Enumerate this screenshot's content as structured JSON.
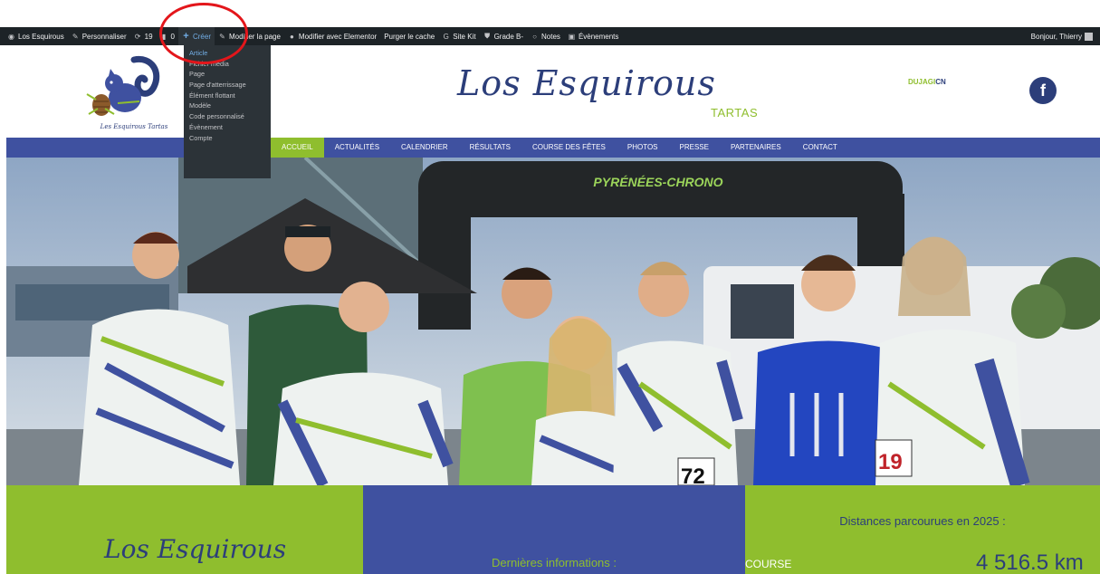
{
  "admin_bar": {
    "items": [
      {
        "label": "Los Esquirous",
        "icon": "wordpress-icon"
      },
      {
        "label": "Personnaliser",
        "icon": "brush-icon"
      },
      {
        "label": "19",
        "icon": "updates-icon"
      },
      {
        "label": "0",
        "icon": "comments-icon"
      },
      {
        "label": "Créer",
        "icon": "plus-icon"
      },
      {
        "label": "Modifier la page",
        "icon": "pencil-icon"
      },
      {
        "label": "Modifier avec Elementor",
        "icon": "elementor-icon"
      },
      {
        "label": "Purger le cache",
        "icon": ""
      },
      {
        "label": "Site Kit",
        "icon": "google-icon"
      },
      {
        "label": "Grade B-",
        "icon": "shield-icon"
      },
      {
        "label": "Notes",
        "icon": "notes-icon"
      },
      {
        "label": "Évènements",
        "icon": "calendar-icon"
      }
    ],
    "greeting": "Bonjour, Thierry"
  },
  "create_menu": {
    "items": [
      "Article",
      "Fichier média",
      "Page",
      "Page d'atterrissage",
      "Élément flottant",
      "Modèle",
      "Code personnalisé",
      "Évènement",
      "Compte"
    ],
    "active_index": 0
  },
  "header": {
    "logo_text": "Les Esquirous Tartas",
    "title": "Los Esquirous",
    "subtitle": "TARTAS",
    "sponsor_a": "DUJAGI",
    "sponsor_b": "CN",
    "facebook_icon": "f"
  },
  "nav": {
    "items": [
      "ACCUEIL",
      "ACTUALITÉS",
      "CALENDRIER",
      "RÉSULTATS",
      "COURSE DES FÊTES",
      "PHOTOS",
      "PRESSE",
      "PARTENAIRES",
      "CONTACT"
    ],
    "active_index": 0
  },
  "hero": {
    "arch_text": "PYRÉNÉES-CHRONO",
    "bibs": [
      "72",
      "19"
    ]
  },
  "panels": {
    "left_title": "Los Esquirous",
    "middle_title": "Dernières informations :",
    "right_title": "Distances parcourues en 2025 :",
    "right_label": "COURSE",
    "right_value": "4 516.5 km"
  },
  "colors": {
    "admin_bar": "#1d2327",
    "brand_blue": "#3f51a0",
    "brand_green": "#8fbe2e",
    "dark_blue": "#2c3e7a",
    "annotation_red": "#e3161b"
  }
}
